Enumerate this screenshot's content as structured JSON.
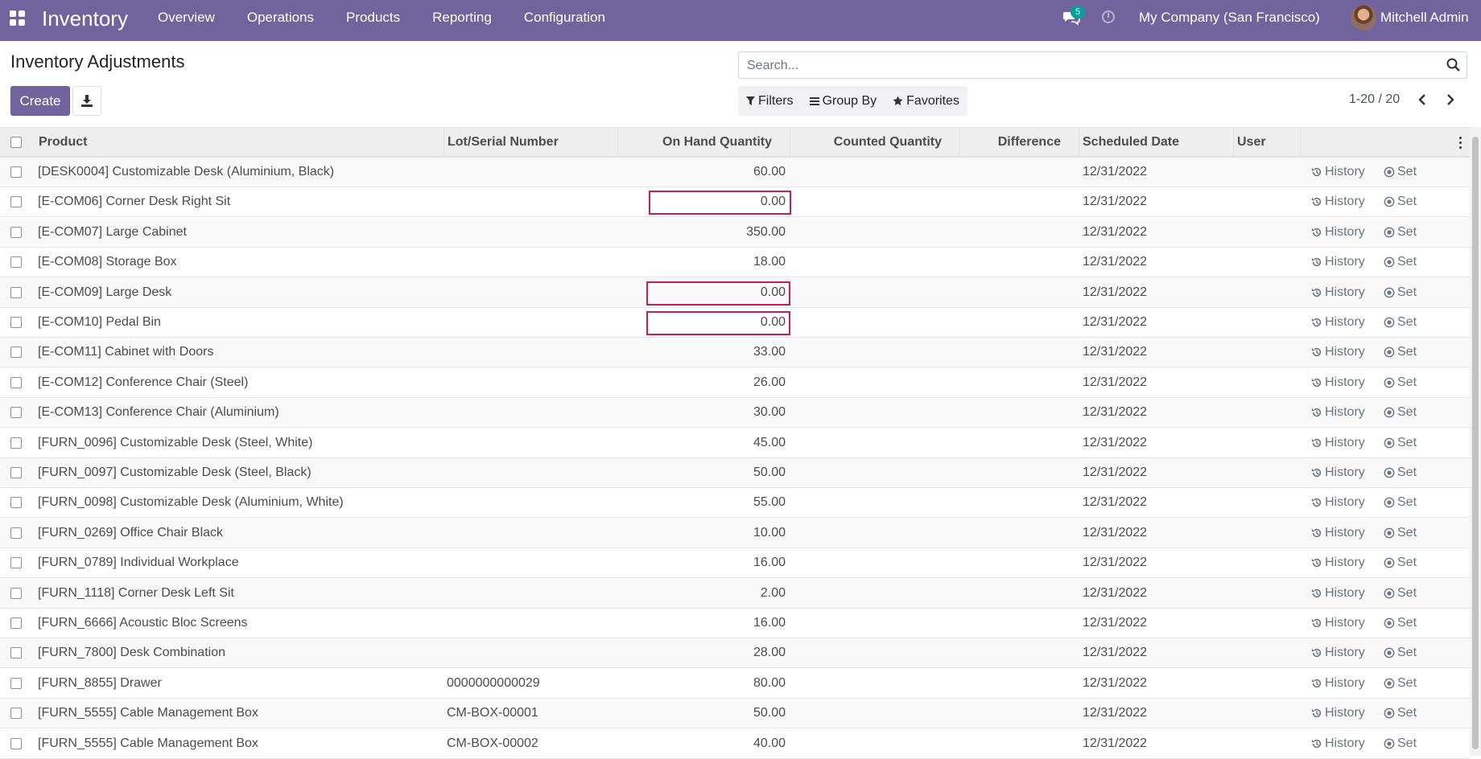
{
  "navbar": {
    "brand": "Inventory",
    "menu": [
      "Overview",
      "Operations",
      "Products",
      "Reporting",
      "Configuration"
    ],
    "chat_count": "5",
    "company": "My Company (San Francisco)",
    "user": "Mitchell Admin",
    "accent_color": "#71639e"
  },
  "control": {
    "title": "Inventory Adjustments",
    "create_label": "Create",
    "search_placeholder": "Search...",
    "filters_label": "Filters",
    "groupby_label": "Group By",
    "favorites_label": "Favorites",
    "pager": "1-20 / 20"
  },
  "table": {
    "columns": [
      "Product",
      "Lot/Serial Number",
      "On Hand Quantity",
      "Counted Quantity",
      "Difference",
      "Scheduled Date",
      "User"
    ],
    "history_label": "History",
    "set_label": "Set",
    "rows": [
      {
        "product": "[DESK0004] Customizable Desk (Aluminium, Black)",
        "lot": "",
        "on_hand": "60.00",
        "warn": false,
        "date": "12/31/2022"
      },
      {
        "product": "[E-COM06] Corner Desk Right Sit",
        "lot": "",
        "on_hand": "0.00",
        "warn": true,
        "date": "12/31/2022"
      },
      {
        "product": "[E-COM07] Large Cabinet",
        "lot": "",
        "on_hand": "350.00",
        "warn": false,
        "date": "12/31/2022"
      },
      {
        "product": "[E-COM08] Storage Box",
        "lot": "",
        "on_hand": "18.00",
        "warn": false,
        "date": "12/31/2022"
      },
      {
        "product": "[E-COM09] Large Desk",
        "lot": "",
        "on_hand": "0.00",
        "warn": true,
        "date": "12/31/2022"
      },
      {
        "product": "[E-COM10] Pedal Bin",
        "lot": "",
        "on_hand": "0.00",
        "warn": true,
        "date": "12/31/2022"
      },
      {
        "product": "[E-COM11] Cabinet with Doors",
        "lot": "",
        "on_hand": "33.00",
        "warn": false,
        "date": "12/31/2022"
      },
      {
        "product": "[E-COM12] Conference Chair (Steel)",
        "lot": "",
        "on_hand": "26.00",
        "warn": false,
        "date": "12/31/2022"
      },
      {
        "product": "[E-COM13] Conference Chair (Aluminium)",
        "lot": "",
        "on_hand": "30.00",
        "warn": false,
        "date": "12/31/2022"
      },
      {
        "product": "[FURN_0096] Customizable Desk (Steel, White)",
        "lot": "",
        "on_hand": "45.00",
        "warn": false,
        "date": "12/31/2022"
      },
      {
        "product": "[FURN_0097] Customizable Desk (Steel, Black)",
        "lot": "",
        "on_hand": "50.00",
        "warn": false,
        "date": "12/31/2022"
      },
      {
        "product": "[FURN_0098] Customizable Desk (Aluminium, White)",
        "lot": "",
        "on_hand": "55.00",
        "warn": false,
        "date": "12/31/2022"
      },
      {
        "product": "[FURN_0269] Office Chair Black",
        "lot": "",
        "on_hand": "10.00",
        "warn": false,
        "date": "12/31/2022"
      },
      {
        "product": "[FURN_0789] Individual Workplace",
        "lot": "",
        "on_hand": "16.00",
        "warn": false,
        "date": "12/31/2022"
      },
      {
        "product": "[FURN_1118] Corner Desk Left Sit",
        "lot": "",
        "on_hand": "2.00",
        "warn": false,
        "date": "12/31/2022"
      },
      {
        "product": "[FURN_6666] Acoustic Bloc Screens",
        "lot": "",
        "on_hand": "16.00",
        "warn": false,
        "date": "12/31/2022"
      },
      {
        "product": "[FURN_7800] Desk Combination",
        "lot": "",
        "on_hand": "28.00",
        "warn": false,
        "date": "12/31/2022"
      },
      {
        "product": "[FURN_8855] Drawer",
        "lot": "0000000000029",
        "on_hand": "80.00",
        "warn": false,
        "date": "12/31/2022"
      },
      {
        "product": "[FURN_5555] Cable Management Box",
        "lot": "CM-BOX-00001",
        "on_hand": "50.00",
        "warn": false,
        "date": "12/31/2022"
      },
      {
        "product": "[FURN_5555] Cable Management Box",
        "lot": "CM-BOX-00002",
        "on_hand": "40.00",
        "warn": false,
        "date": "12/31/2022"
      }
    ]
  }
}
